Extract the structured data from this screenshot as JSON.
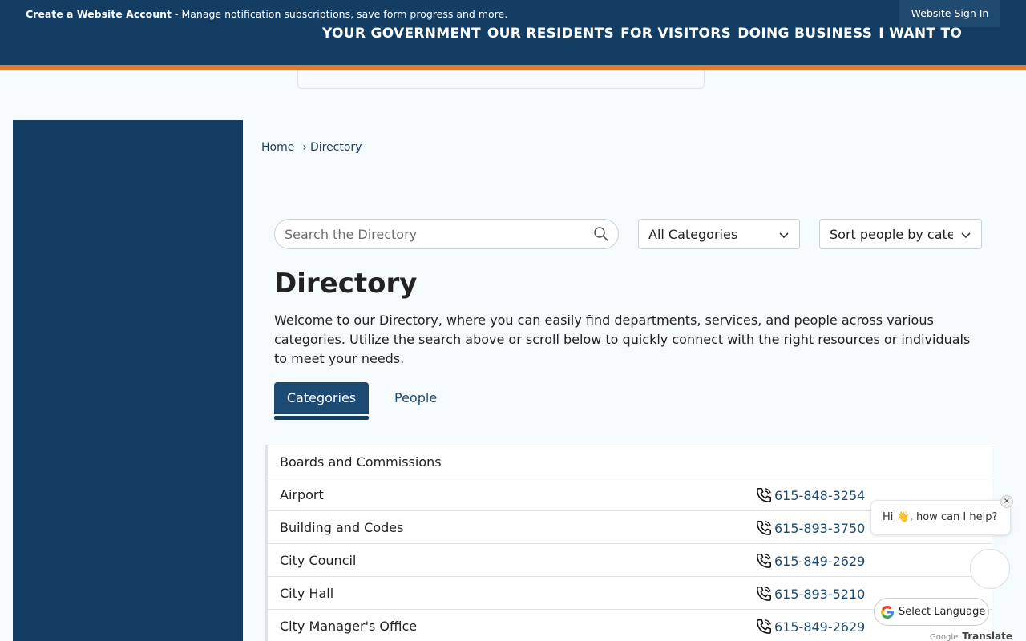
{
  "topbar": {
    "account_title": "Create a Website Account",
    "account_desc": " - Manage notification subscriptions, save form progress and more.",
    "signin_label": "Website Sign In"
  },
  "nav": {
    "items": [
      "YOUR GOVERNMENT",
      "OUR RESIDENTS",
      "FOR VISITORS",
      "DOING BUSINESS",
      "I WANT TO"
    ]
  },
  "breadcrumb": {
    "home": "Home",
    "separator": "›",
    "current": "Directory"
  },
  "search": {
    "placeholder": "Search the Directory"
  },
  "filters": {
    "category": "All Categories",
    "sort": "Sort people by category"
  },
  "page": {
    "title": "Directory",
    "intro": "Welcome to our Directory, where you can easily find departments, services, and people across various categories. Utilize the search above or scroll below to quickly connect with the right resources or individuals to meet your needs."
  },
  "tabs": {
    "categories": "Categories",
    "people": "People"
  },
  "directory": {
    "rows": [
      {
        "name": "Boards and Commissions",
        "phone": ""
      },
      {
        "name": "Airport",
        "phone": "615-848-3254"
      },
      {
        "name": "Building and Codes",
        "phone": "615-893-3750"
      },
      {
        "name": "City Council",
        "phone": "615-849-2629"
      },
      {
        "name": "City Hall",
        "phone": "615-893-5210"
      },
      {
        "name": "City Manager's Office",
        "phone": "615-849-2629"
      }
    ]
  },
  "chat": {
    "greeting": "Hi 👋, how can I help?",
    "close": "×"
  },
  "translate": {
    "label": "Select Language",
    "powered_google": "Google",
    "powered_translate": "Translate"
  },
  "colors": {
    "brand_navy": "#133d62",
    "accent_orange": "#e27a2d",
    "link_blue": "#1d4a73"
  }
}
